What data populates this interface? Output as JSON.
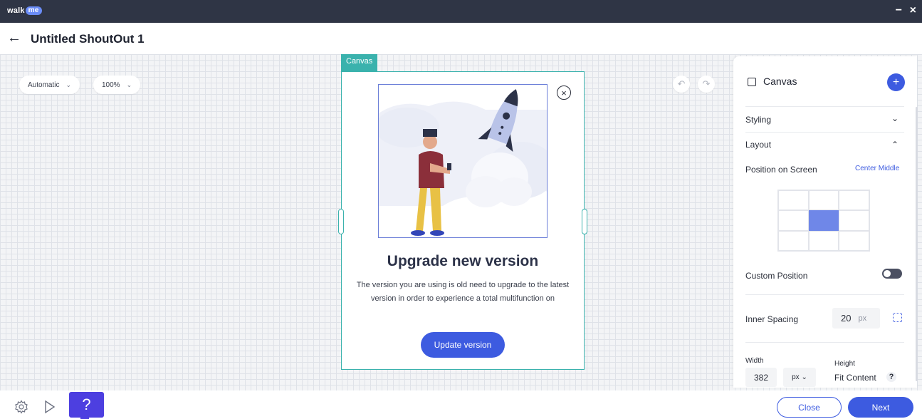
{
  "app": {
    "logo_text": "walk",
    "logo_badge": "me",
    "minimize_symbol": "−",
    "close_symbol": "×"
  },
  "header": {
    "back_symbol": "←",
    "title": "Untitled ShoutOut 1"
  },
  "toolbar": {
    "mode_label": "Automatic",
    "zoom_label": "100%",
    "undo_symbol": "↶",
    "redo_symbol": "↷"
  },
  "canvas": {
    "tag_label": "Canvas",
    "close_symbol": "×",
    "title": "Upgrade new version",
    "body": "The version you are using is old need to upgrade to the latest version in order to experience a total multifunction on",
    "button_label": "Update version"
  },
  "panel": {
    "title": "Canvas",
    "add_symbol": "+",
    "styling_label": "Styling",
    "layout_label": "Layout",
    "position_label": "Position on Screen",
    "position_value": "Center Middle",
    "custom_position_label": "Custom Position",
    "custom_position_on": false,
    "inner_spacing_label": "Inner Spacing",
    "inner_spacing_value": "20",
    "inner_spacing_unit": "px",
    "width_label": "Width",
    "width_value": "382",
    "width_unit": "px",
    "height_label": "Height",
    "height_value": "Fit Content",
    "help_symbol": "?"
  },
  "footer": {
    "help_symbol": "?",
    "close_label": "Close",
    "next_label": "Next"
  },
  "colors": {
    "primary": "#3d5be0",
    "canvas_border": "#3ab2ad",
    "titlebar": "#2f3545",
    "help_button": "#4d3fe0"
  }
}
